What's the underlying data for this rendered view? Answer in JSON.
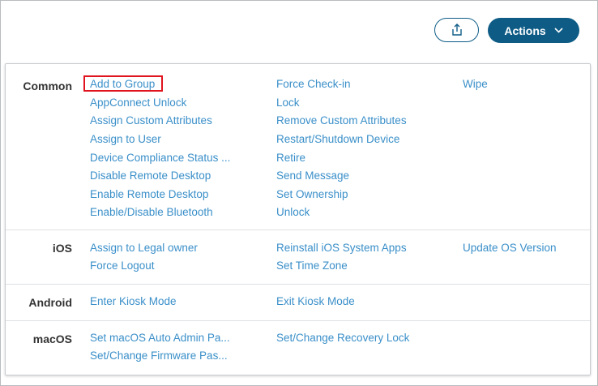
{
  "header": {
    "export_icon": "upload-export-icon",
    "actions_label": "Actions",
    "actions_chevron": "chevron-down-icon"
  },
  "sections": {
    "common": {
      "label": "Common",
      "col1": [
        "Add to Group",
        "AppConnect Unlock",
        "Assign Custom Attributes",
        "Assign to User",
        "Device Compliance Status ...",
        "Disable Remote Desktop",
        "Enable Remote Desktop",
        "Enable/Disable Bluetooth"
      ],
      "col2": [
        "Force Check-in",
        "Lock",
        "Remove Custom Attributes",
        "Restart/Shutdown Device",
        "Retire",
        "Send Message",
        "Set Ownership",
        "Unlock"
      ],
      "col3": [
        "Wipe"
      ]
    },
    "ios": {
      "label": "iOS",
      "col1": [
        "Assign to Legal owner",
        "Force Logout"
      ],
      "col2": [
        "Reinstall iOS System Apps",
        "Set Time Zone"
      ],
      "col3": [
        "Update OS Version"
      ]
    },
    "android": {
      "label": "Android",
      "col1": [
        "Enter Kiosk Mode"
      ],
      "col2": [
        "Exit Kiosk Mode"
      ]
    },
    "macos": {
      "label": "macOS",
      "col1": [
        "Set macOS Auto Admin Pa...",
        "Set/Change Firmware Pas..."
      ],
      "col2": [
        "Set/Change Recovery Lock"
      ]
    }
  },
  "colors": {
    "link": "#3a8fc9",
    "primary": "#0e5c86",
    "highlight": "#e0141e"
  }
}
